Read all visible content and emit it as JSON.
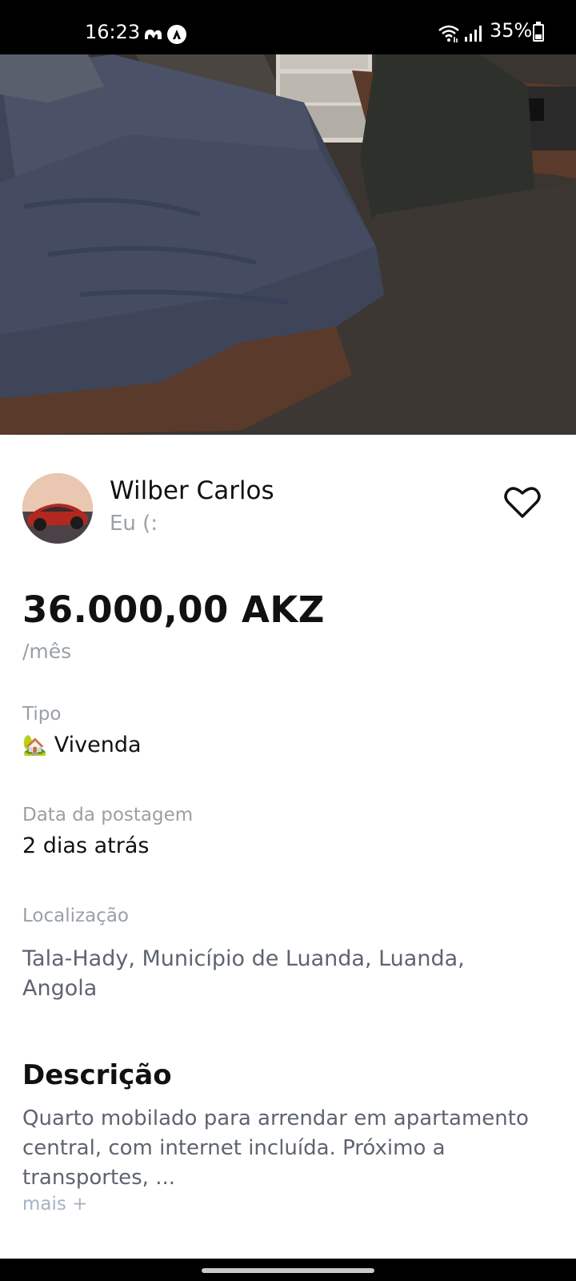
{
  "status_bar": {
    "time": "16:23",
    "battery_text": "35%",
    "battery_level": 0.35,
    "icons": [
      "messenger-icon",
      "nav-arrow-icon",
      "wifi-icon",
      "signal-icon",
      "battery-icon"
    ]
  },
  "listing": {
    "image_alt": "bedroom-photo",
    "seller": {
      "name": "Wilber Carlos",
      "subtitle": "Eu (:"
    },
    "price": "36.000,00 AKZ",
    "period": "/mês",
    "type": {
      "label": "Tipo",
      "icon": "🏡",
      "value": "Vivenda"
    },
    "posted": {
      "label": "Data da postagem",
      "value": "2 dias atrás"
    },
    "location": {
      "label": "Localização",
      "value": "Tala-Hady, Município de Luanda, Luanda, Angola"
    },
    "description": {
      "title": "Descrição",
      "text": "Quarto mobilado para arrendar em apartamento central, com internet incluída. Próximo a transportes, ...",
      "more_label": "mais +"
    }
  }
}
